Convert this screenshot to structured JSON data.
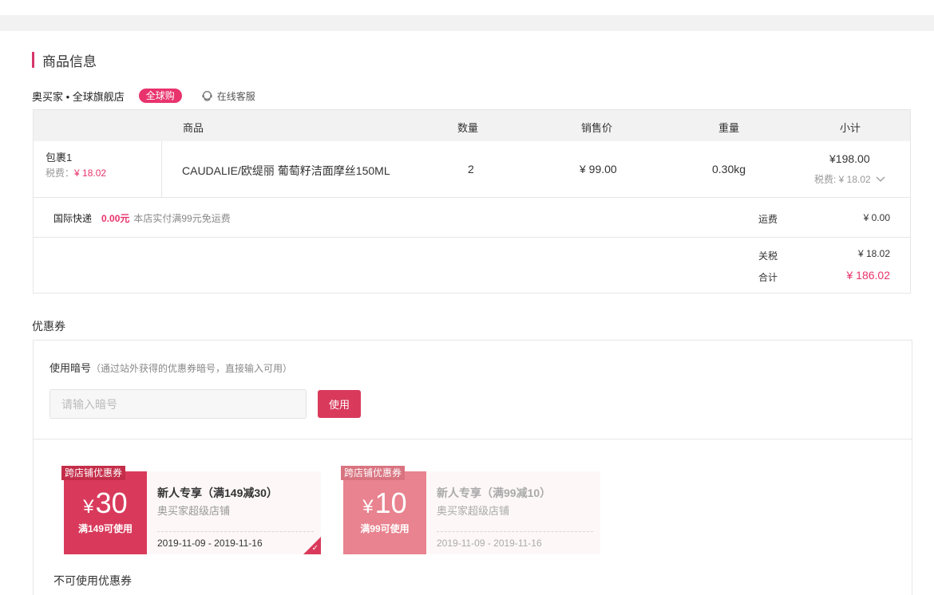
{
  "section": {
    "title": "商品信息"
  },
  "store": {
    "name": "奥买家 • 全球旗舰店",
    "badge": "全球购",
    "service_label": "在线客服"
  },
  "table": {
    "headers": [
      "商品",
      "数量",
      "销售价",
      "重量",
      "小计"
    ],
    "package": {
      "name": "包裹1",
      "tax_label": "税费：",
      "tax_value": "¥ 18.02"
    },
    "product": {
      "name": "CAUDALIE/欧缇丽 葡萄籽洁面摩丝150ML",
      "qty": "2",
      "price": "¥ 99.00",
      "weight": "0.30kg",
      "subtotal": "¥198.00",
      "subtotal_tax": "税费: ¥ 18.02"
    }
  },
  "shipping": {
    "method": "国际快递",
    "fee": "0.00元",
    "note": "本店实付满99元免运费",
    "label": "运费",
    "value": "¥ 0.00"
  },
  "summary": {
    "tariff_label": "关税",
    "tariff_value": "¥ 18.02",
    "total_label": "合计",
    "total_value": "¥ 186.02"
  },
  "coupons": {
    "title": "优惠券",
    "code_label": "使用暗号",
    "code_hint": "（通过站外获得的优惠券暗号，直接输入可用）",
    "code_placeholder": "请输入暗号",
    "use_button": "使用",
    "unusable_title": "不可使用优惠券",
    "items": [
      {
        "tag": "跨店铺优惠券",
        "currency": "¥",
        "amount": "30",
        "condition": "满149可使用",
        "title": "新人专享（满149减30）",
        "shop": "奥买家超级店铺",
        "date": "2019-11-09 - 2019-11-16",
        "selected": true
      },
      {
        "tag": "跨店铺优惠券",
        "currency": "¥",
        "amount": "10",
        "condition": "满99可使用",
        "title": "新人专享（满99减10）",
        "shop": "奥买家超级店铺",
        "date": "2019-11-09 - 2019-11-16",
        "selected": false
      }
    ]
  },
  "colors": {
    "accent": "#d6356a",
    "coupon_active": "#d93a5b",
    "coupon_inactive": "#e8838f"
  }
}
